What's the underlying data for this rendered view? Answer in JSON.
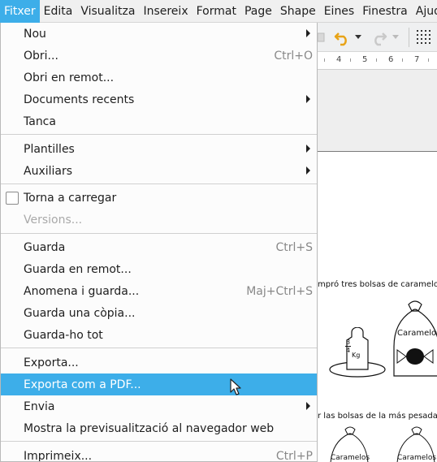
{
  "menubar": {
    "items": [
      "Fitxer",
      "Edita",
      "Visualitza",
      "Insereix",
      "Format",
      "Page",
      "Shape",
      "Eines",
      "Finestra",
      "Ajuda"
    ],
    "active_index": 0
  },
  "file_menu": {
    "items": [
      {
        "label": "Nou",
        "submenu": true
      },
      {
        "label": "Obri...",
        "shortcut": "Ctrl+O"
      },
      {
        "label": "Obri en remot..."
      },
      {
        "label": "Documents recents",
        "submenu": true
      },
      {
        "label": "Tanca"
      },
      {
        "label": "Plantilles",
        "submenu": true
      },
      {
        "label": "Auxiliars",
        "submenu": true
      },
      {
        "label": "Torna a carregar",
        "checkbox": true,
        "checked": false
      },
      {
        "label": "Versions...",
        "disabled": true
      },
      {
        "label": "Guarda",
        "shortcut": "Ctrl+S"
      },
      {
        "label": "Guarda en remot..."
      },
      {
        "label": "Anomena i guarda...",
        "shortcut": "Maj+Ctrl+S"
      },
      {
        "label": "Guarda una còpia..."
      },
      {
        "label": "Guarda-ho tot"
      },
      {
        "label": "Exporta..."
      },
      {
        "label": "Exporta com a PDF...",
        "highlighted": true
      },
      {
        "label": "Envia",
        "submenu": true
      },
      {
        "label": "Mostra la previsualització al navegador web"
      },
      {
        "label": "Imprimeix...",
        "shortcut": "Ctrl+P"
      }
    ]
  },
  "ruler": {
    "numbers": [
      "4",
      "5",
      "6",
      "7"
    ]
  },
  "document": {
    "text_line_1": "mpró tres bolsas de caramelos",
    "text_line_2": "r las bolsas de la más pesada",
    "weight_label": "Kg",
    "fraction_num": "3",
    "fraction_den": "4",
    "bag_label_1": "Caramelos",
    "bag_label_2": "Caramelos",
    "bag_label_3": "Caramelos"
  },
  "colors": {
    "accent": "#3daee9",
    "menu_bg": "#fcfcfc",
    "menubar_bg": "#f0f0f0",
    "disabled_text": "#a9a9a9",
    "undo_icon": "#e8a317"
  },
  "icons": [
    "undo-icon",
    "redo-icon",
    "chevron-down-icon",
    "grid-icon",
    "submenu-arrow-icon",
    "mouse-pointer-icon"
  ]
}
